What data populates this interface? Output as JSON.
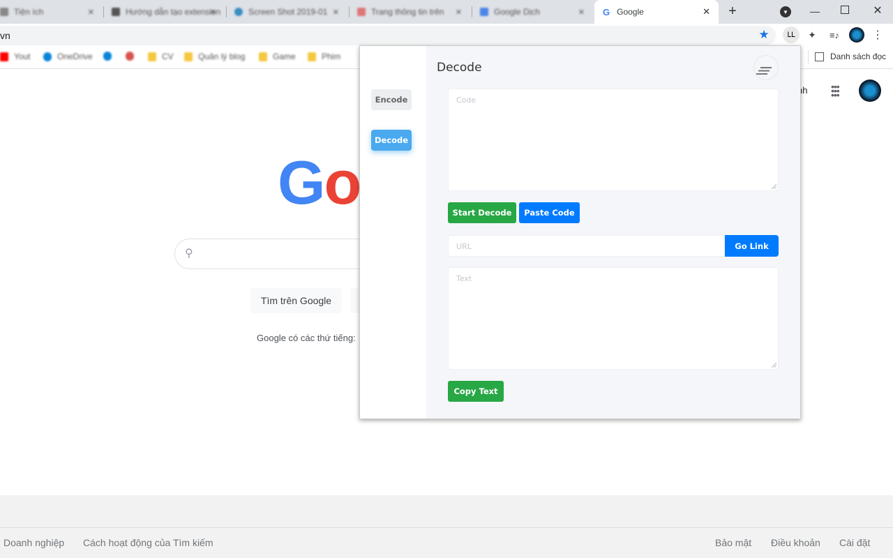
{
  "browser": {
    "tabs": [
      {
        "label": "Tiện ích"
      },
      {
        "label": "Hướng dẫn tạo extension"
      },
      {
        "label": "Screen Shot 2019-01"
      },
      {
        "label": "Trang thông tin trên"
      },
      {
        "label": "Google Dịch"
      }
    ],
    "active_tab": {
      "label": "Google"
    },
    "address": "vn",
    "bookmarks": [
      {
        "label": "Yout",
        "color": "#ff0000"
      },
      {
        "label": "OneDrive",
        "color": "#0a84d8"
      },
      {
        "label": "",
        "color": "#0a84d8"
      },
      {
        "label": "",
        "color": "#d9534f"
      },
      {
        "label": "CV",
        "color": "#f5c842"
      },
      {
        "label": "Quản lý blog",
        "color": "#f5c842"
      },
      {
        "label": "Game",
        "color": "#f5c842"
      },
      {
        "label": "Phim",
        "color": "#f5c842"
      }
    ],
    "reading_list": "Danh sách đọc"
  },
  "google": {
    "logo_partial": "Go",
    "search_button": "Tìm trên Google",
    "languages_text": "Google có các thứ tiếng:",
    "header_partial": "nh",
    "footer": {
      "left": [
        "Doanh nghiệp",
        "Cách hoạt động của Tìm kiếm"
      ],
      "right": [
        "Bảo mật",
        "Điều khoản",
        "Cài đặt"
      ]
    }
  },
  "popup": {
    "title": "Decode",
    "nav": {
      "encode": "Encode",
      "decode": "Decode"
    },
    "code_placeholder": "Code",
    "start_decode": "Start Decode",
    "paste_code": "Paste Code",
    "url_placeholder": "URL",
    "go_link": "Go Link",
    "text_placeholder": "Text",
    "copy_text": "Copy Text",
    "colors": {
      "green": "#28a745",
      "blue": "#007bff",
      "active_nav": "#4aa9ef"
    }
  }
}
